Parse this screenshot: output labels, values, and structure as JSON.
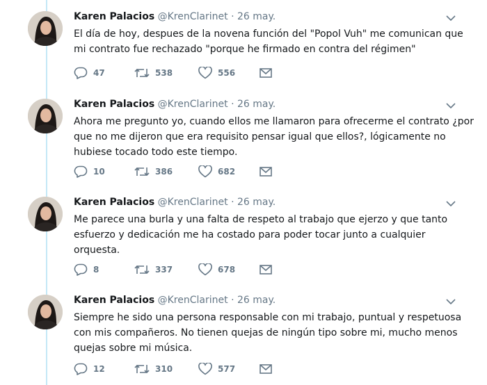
{
  "tweets": [
    {
      "name": "Karen Palacios",
      "handle": "@KrenClarinet",
      "separator": "·",
      "date": "26 may.",
      "text": "El día de hoy, despues de la novena función del \"Popol Vuh\" me comunican que mi contrato fue rechazado \"porque he firmado en contra del régimen\"",
      "replies": "47",
      "retweets": "538",
      "likes": "556"
    },
    {
      "name": "Karen Palacios",
      "handle": "@KrenClarinet",
      "separator": "·",
      "date": "26 may.",
      "text": "Ahora me pregunto yo, cuando ellos me llamaron para ofrecerme el contrato ¿por que no me dijeron que era requisito pensar igual que ellos?, lógicamente no hubiese tocado todo este tiempo.",
      "replies": "10",
      "retweets": "386",
      "likes": "682"
    },
    {
      "name": "Karen Palacios",
      "handle": "@KrenClarinet",
      "separator": "·",
      "date": "26 may.",
      "text": "Me parece una burla y una falta de respeto al trabajo que ejerzo y que tanto esfuerzo y dedicación me ha costado para poder tocar junto a cualquier orquesta.",
      "replies": "8",
      "retweets": "337",
      "likes": "678"
    },
    {
      "name": "Karen Palacios",
      "handle": "@KrenClarinet",
      "separator": "·",
      "date": "26 may.",
      "text": "Siempre he sido una persona responsable con mi trabajo, puntual y respetuosa con mis compañeros. No tienen quejas de ningún tipo sobre mi, mucho menos quejas sobre mi música.",
      "replies": "12",
      "retweets": "310",
      "likes": "577"
    }
  ],
  "icons": {
    "reply": "reply-icon",
    "retweet": "retweet-icon",
    "like": "heart-icon",
    "message": "envelope-icon",
    "more": "chevron-down-icon"
  },
  "colors": {
    "text": "#14171a",
    "muted": "#657786",
    "thread_line": "#c4e8f7"
  }
}
